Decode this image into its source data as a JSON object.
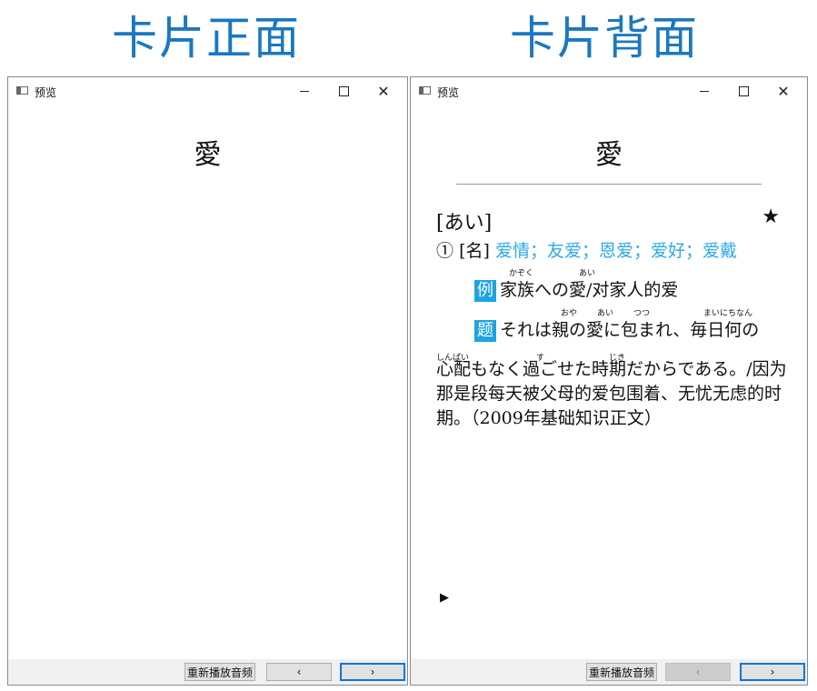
{
  "captions": {
    "front": "卡片正面",
    "back": "卡片背面"
  },
  "front_window": {
    "title": "预览",
    "word": "愛",
    "buttons": {
      "replay": "重新播放音频",
      "prev": "‹",
      "next": "›"
    }
  },
  "back_window": {
    "title": "预览",
    "word": "愛",
    "reading": "[あい]",
    "star": "★",
    "definition": {
      "number": "①",
      "pos": "[名]",
      "meanings": "爱情；友爱；恩爱；爱好；爱戴"
    },
    "example1": {
      "tag": "例",
      "text": "家族への愛/对家人的爱",
      "furigana": [
        "かぞく",
        "あい"
      ]
    },
    "example2": {
      "tag": "题",
      "text": "それは親の愛に包まれ、毎日何の",
      "furigana": [
        "おや",
        "あい",
        "つつ",
        "まいにちなん"
      ],
      "continuation_furigana": [
        "しんぱい",
        "す",
        "じき"
      ],
      "continuation": "心配もなく過ごせた時期だからである。/因为那是段每天被父母的爱包围着、无忧无虑的时期。（2009年基础知识正文）"
    },
    "play_icon": "▶",
    "buttons": {
      "replay": "重新播放音频",
      "prev": "‹",
      "next": "›"
    }
  }
}
